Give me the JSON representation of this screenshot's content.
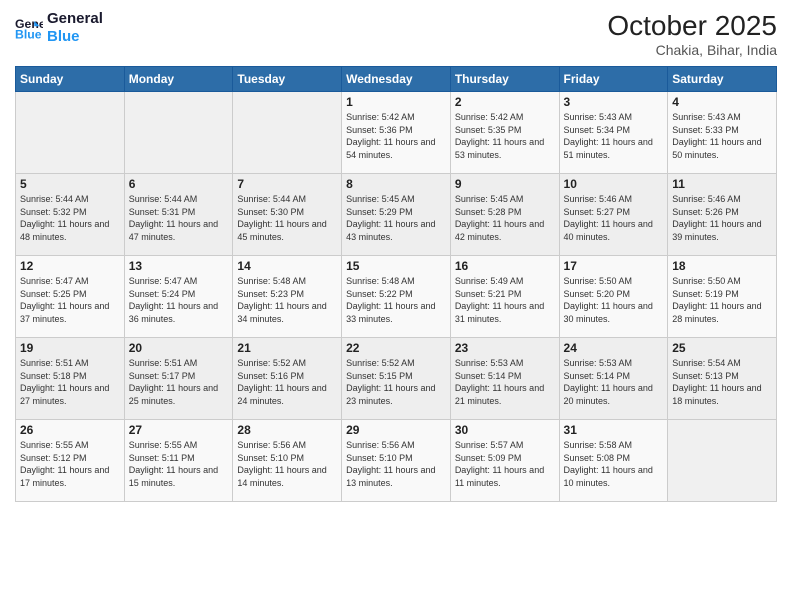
{
  "header": {
    "logo_line1": "General",
    "logo_line2": "Blue",
    "month": "October 2025",
    "location": "Chakia, Bihar, India"
  },
  "days_of_week": [
    "Sunday",
    "Monday",
    "Tuesday",
    "Wednesday",
    "Thursday",
    "Friday",
    "Saturday"
  ],
  "weeks": [
    [
      {
        "day": "",
        "sunrise": "",
        "sunset": "",
        "daylight": ""
      },
      {
        "day": "",
        "sunrise": "",
        "sunset": "",
        "daylight": ""
      },
      {
        "day": "",
        "sunrise": "",
        "sunset": "",
        "daylight": ""
      },
      {
        "day": "1",
        "sunrise": "Sunrise: 5:42 AM",
        "sunset": "Sunset: 5:36 PM",
        "daylight": "Daylight: 11 hours and 54 minutes."
      },
      {
        "day": "2",
        "sunrise": "Sunrise: 5:42 AM",
        "sunset": "Sunset: 5:35 PM",
        "daylight": "Daylight: 11 hours and 53 minutes."
      },
      {
        "day": "3",
        "sunrise": "Sunrise: 5:43 AM",
        "sunset": "Sunset: 5:34 PM",
        "daylight": "Daylight: 11 hours and 51 minutes."
      },
      {
        "day": "4",
        "sunrise": "Sunrise: 5:43 AM",
        "sunset": "Sunset: 5:33 PM",
        "daylight": "Daylight: 11 hours and 50 minutes."
      }
    ],
    [
      {
        "day": "5",
        "sunrise": "Sunrise: 5:44 AM",
        "sunset": "Sunset: 5:32 PM",
        "daylight": "Daylight: 11 hours and 48 minutes."
      },
      {
        "day": "6",
        "sunrise": "Sunrise: 5:44 AM",
        "sunset": "Sunset: 5:31 PM",
        "daylight": "Daylight: 11 hours and 47 minutes."
      },
      {
        "day": "7",
        "sunrise": "Sunrise: 5:44 AM",
        "sunset": "Sunset: 5:30 PM",
        "daylight": "Daylight: 11 hours and 45 minutes."
      },
      {
        "day": "8",
        "sunrise": "Sunrise: 5:45 AM",
        "sunset": "Sunset: 5:29 PM",
        "daylight": "Daylight: 11 hours and 43 minutes."
      },
      {
        "day": "9",
        "sunrise": "Sunrise: 5:45 AM",
        "sunset": "Sunset: 5:28 PM",
        "daylight": "Daylight: 11 hours and 42 minutes."
      },
      {
        "day": "10",
        "sunrise": "Sunrise: 5:46 AM",
        "sunset": "Sunset: 5:27 PM",
        "daylight": "Daylight: 11 hours and 40 minutes."
      },
      {
        "day": "11",
        "sunrise": "Sunrise: 5:46 AM",
        "sunset": "Sunset: 5:26 PM",
        "daylight": "Daylight: 11 hours and 39 minutes."
      }
    ],
    [
      {
        "day": "12",
        "sunrise": "Sunrise: 5:47 AM",
        "sunset": "Sunset: 5:25 PM",
        "daylight": "Daylight: 11 hours and 37 minutes."
      },
      {
        "day": "13",
        "sunrise": "Sunrise: 5:47 AM",
        "sunset": "Sunset: 5:24 PM",
        "daylight": "Daylight: 11 hours and 36 minutes."
      },
      {
        "day": "14",
        "sunrise": "Sunrise: 5:48 AM",
        "sunset": "Sunset: 5:23 PM",
        "daylight": "Daylight: 11 hours and 34 minutes."
      },
      {
        "day": "15",
        "sunrise": "Sunrise: 5:48 AM",
        "sunset": "Sunset: 5:22 PM",
        "daylight": "Daylight: 11 hours and 33 minutes."
      },
      {
        "day": "16",
        "sunrise": "Sunrise: 5:49 AM",
        "sunset": "Sunset: 5:21 PM",
        "daylight": "Daylight: 11 hours and 31 minutes."
      },
      {
        "day": "17",
        "sunrise": "Sunrise: 5:50 AM",
        "sunset": "Sunset: 5:20 PM",
        "daylight": "Daylight: 11 hours and 30 minutes."
      },
      {
        "day": "18",
        "sunrise": "Sunrise: 5:50 AM",
        "sunset": "Sunset: 5:19 PM",
        "daylight": "Daylight: 11 hours and 28 minutes."
      }
    ],
    [
      {
        "day": "19",
        "sunrise": "Sunrise: 5:51 AM",
        "sunset": "Sunset: 5:18 PM",
        "daylight": "Daylight: 11 hours and 27 minutes."
      },
      {
        "day": "20",
        "sunrise": "Sunrise: 5:51 AM",
        "sunset": "Sunset: 5:17 PM",
        "daylight": "Daylight: 11 hours and 25 minutes."
      },
      {
        "day": "21",
        "sunrise": "Sunrise: 5:52 AM",
        "sunset": "Sunset: 5:16 PM",
        "daylight": "Daylight: 11 hours and 24 minutes."
      },
      {
        "day": "22",
        "sunrise": "Sunrise: 5:52 AM",
        "sunset": "Sunset: 5:15 PM",
        "daylight": "Daylight: 11 hours and 23 minutes."
      },
      {
        "day": "23",
        "sunrise": "Sunrise: 5:53 AM",
        "sunset": "Sunset: 5:14 PM",
        "daylight": "Daylight: 11 hours and 21 minutes."
      },
      {
        "day": "24",
        "sunrise": "Sunrise: 5:53 AM",
        "sunset": "Sunset: 5:14 PM",
        "daylight": "Daylight: 11 hours and 20 minutes."
      },
      {
        "day": "25",
        "sunrise": "Sunrise: 5:54 AM",
        "sunset": "Sunset: 5:13 PM",
        "daylight": "Daylight: 11 hours and 18 minutes."
      }
    ],
    [
      {
        "day": "26",
        "sunrise": "Sunrise: 5:55 AM",
        "sunset": "Sunset: 5:12 PM",
        "daylight": "Daylight: 11 hours and 17 minutes."
      },
      {
        "day": "27",
        "sunrise": "Sunrise: 5:55 AM",
        "sunset": "Sunset: 5:11 PM",
        "daylight": "Daylight: 11 hours and 15 minutes."
      },
      {
        "day": "28",
        "sunrise": "Sunrise: 5:56 AM",
        "sunset": "Sunset: 5:10 PM",
        "daylight": "Daylight: 11 hours and 14 minutes."
      },
      {
        "day": "29",
        "sunrise": "Sunrise: 5:56 AM",
        "sunset": "Sunset: 5:10 PM",
        "daylight": "Daylight: 11 hours and 13 minutes."
      },
      {
        "day": "30",
        "sunrise": "Sunrise: 5:57 AM",
        "sunset": "Sunset: 5:09 PM",
        "daylight": "Daylight: 11 hours and 11 minutes."
      },
      {
        "day": "31",
        "sunrise": "Sunrise: 5:58 AM",
        "sunset": "Sunset: 5:08 PM",
        "daylight": "Daylight: 11 hours and 10 minutes."
      },
      {
        "day": "",
        "sunrise": "",
        "sunset": "",
        "daylight": ""
      }
    ]
  ]
}
